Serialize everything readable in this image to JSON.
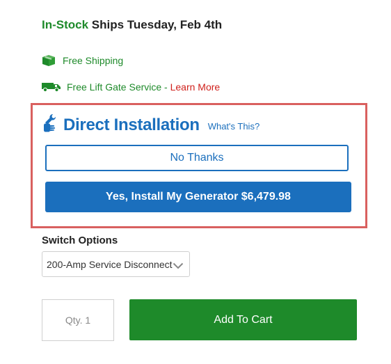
{
  "stock": {
    "status": "In-Stock",
    "ship_text": "Ships Tuesday, Feb 4th"
  },
  "shipping": {
    "free_shipping": "Free Shipping",
    "lift_gate": "Free Lift Gate Service - ",
    "learn_more": "Learn More",
    "icons": [
      "box-icon",
      "truck-icon"
    ]
  },
  "installation": {
    "title": "Direct Installation",
    "whats_this": "What's This?",
    "no_thanks": "No Thanks",
    "yes_install": "Yes, Install My Generator $6,479.98",
    "icon": "wrench-hand-icon"
  },
  "switch_options": {
    "label": "Switch Options",
    "selected": "200-Amp Service Disconnect"
  },
  "cart": {
    "qty_placeholder": "Qty. 1",
    "add_to_cart": "Add To Cart"
  },
  "colors": {
    "green": "#1e8a2a",
    "blue": "#1b6fbd",
    "red": "#d0211c",
    "highlight_border": "#d9605f"
  }
}
